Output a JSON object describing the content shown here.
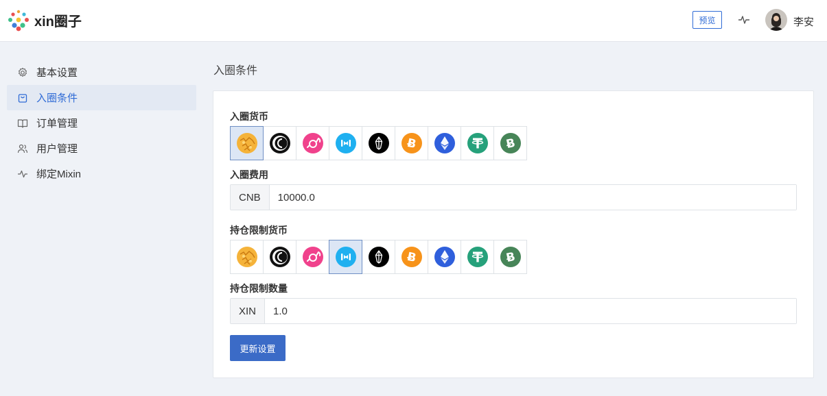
{
  "header": {
    "logo_text": "xin圈子",
    "preview_label": "预览",
    "user_name": "李安"
  },
  "sidebar": {
    "items": [
      {
        "label": "基本设置",
        "icon": "gear-icon"
      },
      {
        "label": "入圈条件",
        "icon": "bag-icon",
        "active": true
      },
      {
        "label": "订单管理",
        "icon": "book-icon"
      },
      {
        "label": "用户管理",
        "icon": "users-icon"
      },
      {
        "label": "绑定Mixin",
        "icon": "activity-icon"
      }
    ]
  },
  "main": {
    "page_title": "入圈条件",
    "join_currency_label": "入圈货币",
    "join_fee_label": "入圈费用",
    "join_fee_unit": "CNB",
    "join_fee_value": "10000.0",
    "hold_currency_label": "持仓限制货币",
    "hold_amount_label": "持仓限制数量",
    "hold_amount_unit": "XIN",
    "hold_amount_value": "1.0",
    "submit_label": "更新设置",
    "coins": [
      "cnb-icon",
      "xin-icon",
      "candy-icon",
      "mixin-icon",
      "eos-icon",
      "btc-icon",
      "eth-icon",
      "usdt-icon",
      "bch-icon"
    ],
    "join_selected_index": 0,
    "hold_selected_index": 3
  },
  "colors": {
    "accent": "#2f6bd6",
    "button": "#3b6bc7",
    "selected_bg": "#dce6f5"
  }
}
